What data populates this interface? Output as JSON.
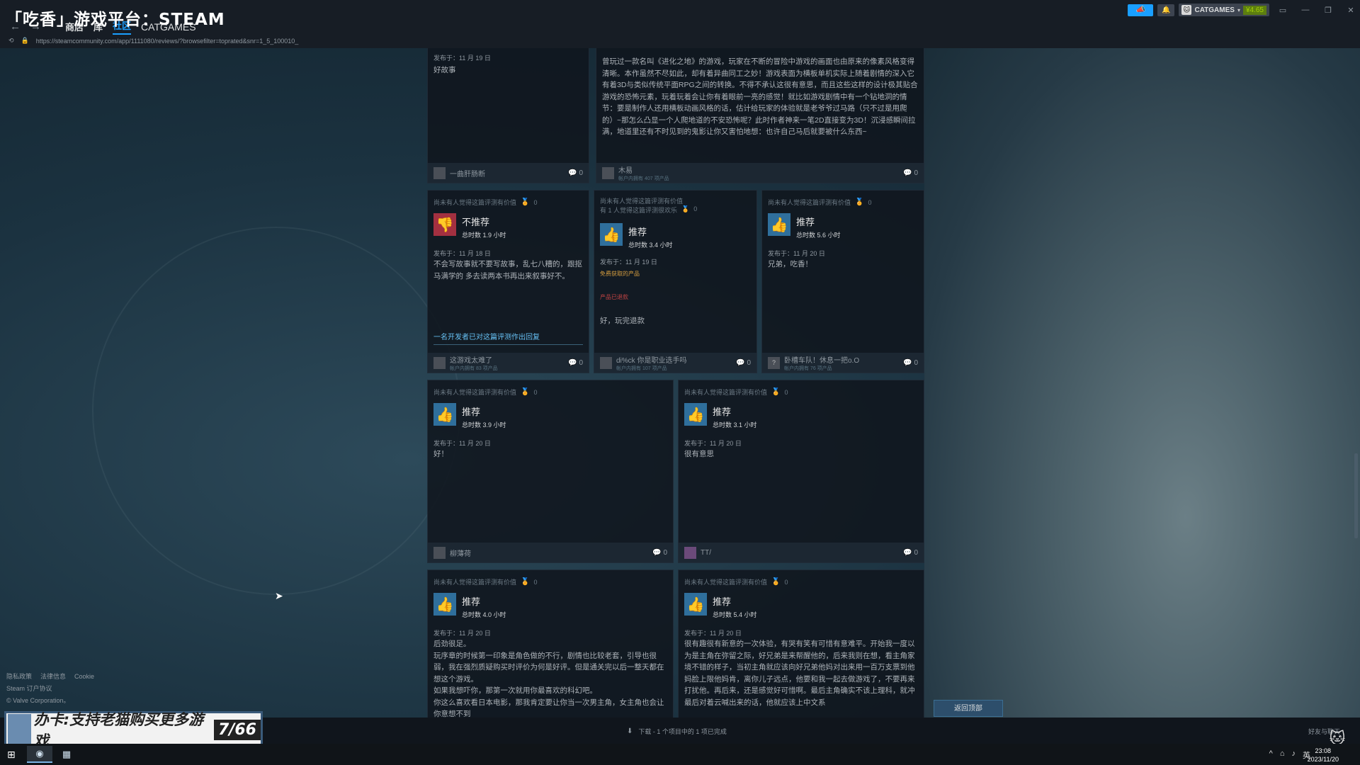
{
  "overlay_title": "「吃香」游戏平台：STEAM",
  "nav": {
    "store": "商店",
    "library": "库",
    "community": "社区",
    "username_tab": "CATGAMES"
  },
  "url": "https://steamcommunity.com/app/1111080/reviews/?browsefilter=toprated&snr=1_5_100010_",
  "account": {
    "name": "CATGAMES",
    "wallet": "¥4.65"
  },
  "reviews": [
    {
      "id": "r1",
      "posted": "发布于：11 月 19 日",
      "body": "好故事",
      "user": "一曲肝肠断",
      "user_sub": "",
      "comments": "0"
    },
    {
      "id": "r2",
      "body": "曾玩过一款名叫《进化之地》的游戏，玩家在不断的冒险中游戏的画面也由原来的像素风格变得清晰。本作虽然不尽如此，却有着异曲同工之妙！游戏表面为横板单机实际上随着剧情的深入它有着3D与类似传统平面RPG之间的转换。不得不承认这很有意思，而且这些这样的设计极其贴合游戏的恐怖元素，玩着玩着会让你有着眼前一亮的感觉！就比如游戏剧情中有一个钻地洞的情节：要是制作人还用横板动画风格的话，估计给玩家的体验就是老爷爷过马路（只不过是用爬的）~那怎么凸显一个人爬地道的不安恐怖呢？此时作者神来一笔2D直接变为3D！沉浸感瞬间拉满，地道里还有不时见到的鬼影让你又害怕地想：也许自己马后就要被什么东西~",
      "user": "木易",
      "user_sub": "帐户内拥有 407 项产品",
      "comments": "0"
    },
    {
      "id": "r3",
      "helpful": "尚未有人觉得这篇评测有价值",
      "award": "0",
      "verdict": "不推荐",
      "hours": "总时数 1.9 小时",
      "posted": "发布于：11 月 18 日",
      "body": "不会写故事就不要写故事，乱七八糟的，跟抠马满学的 多去读两本书再出来叙事好不。",
      "dev_reply": "一名开发者已对这篇评测作出回复",
      "user": "这游戏太难了",
      "user_sub": "帐户内拥有 83 项产品",
      "comments": "0"
    },
    {
      "id": "r4",
      "helpful": "尚未有人觉得这篇评测有价值",
      "helpful2": "有 1 人觉得这篇评测很欢乐",
      "award": "0",
      "verdict": "推荐",
      "hours": "总时数 3.4 小时",
      "posted": "发布于：11 月 19 日",
      "free_tag": "免费获取的产品",
      "refund_tag": "产品已退款",
      "body": "好，玩完退款",
      "user": "di%ck 你是职业选手吗",
      "user_sub": "帐户内拥有 107 项产品",
      "comments": "0"
    },
    {
      "id": "r5",
      "helpful": "尚未有人觉得这篇评测有价值",
      "award": "0",
      "verdict": "推荐",
      "hours": "总时数 5.6 小时",
      "posted": "发布于：11 月 20 日",
      "body": "兄弟，吃香！",
      "user": "卧槽车队！休息一把o.O",
      "user_sub": "帐户内拥有 76 项产品",
      "comments": "0"
    },
    {
      "id": "r6",
      "helpful": "尚未有人觉得这篇评测有价值",
      "award": "0",
      "verdict": "推荐",
      "hours": "总时数 3.9 小时",
      "posted": "发布于：11 月 20 日",
      "body": "好！",
      "user": "柳薄荷",
      "user_sub": "",
      "comments": "0"
    },
    {
      "id": "r7",
      "helpful": "尚未有人觉得这篇评测有价值",
      "award": "0",
      "verdict": "推荐",
      "hours": "总时数 3.1 小时",
      "posted": "发布于：11 月 20 日",
      "body": "很有意思",
      "user": "TT/",
      "user_sub": "",
      "comments": "0"
    },
    {
      "id": "r8",
      "helpful": "尚未有人觉得这篇评测有价值",
      "award": "0",
      "verdict": "推荐",
      "hours": "总时数 4.0 小时",
      "posted": "发布于：11 月 20 日",
      "body": "后劲很足。\n玩序章的时候第一印象是角色做的不行，剧情也比较老套，引导也很弱，我在强烈质疑购买时评价为何是好评。但是通关完以后一整天都在想这个游戏。\n如果我想吓你，那第一次就用你最喜欢的科幻吧。\n你这么喜欢看日本电影，那我肯定要让你当一次男主角，女主角也会让你意想不到"
    },
    {
      "id": "r9",
      "helpful": "尚未有人觉得这篇评测有价值",
      "award": "0",
      "verdict": "推荐",
      "hours": "总时数 5.4 小时",
      "posted": "发布于：11 月 20 日",
      "body": "很有趣很有新意的一次体验，有哭有笑有可惜有意难平。开始我一度以为是主角在弥留之际，好兄弟是来帮醒他的，后来我则在想，看主角家境不错的样子，当初主角就应该向好兄弟他妈对出来用一百万支票到他妈脸上限他妈肯，离你儿子远点，他要和我一起去做游戏了，不要再来打扰他。再后来，还是感觉好可惜啊。最后主角确实不该上理科，就冲最后对着云喊出来的话，他就应该上中文系"
    }
  ],
  "footer": {
    "privacy": "隐私政策",
    "legal": "法律信息",
    "cookie": "Cookie",
    "ssa": "Steam 订户协议",
    "copyright": "© Valve Corporation。"
  },
  "back_to_top": "返回顶部",
  "promo": {
    "text": "办卡:支持老猫购买更多游戏",
    "number": "7/66"
  },
  "download_status": "下载 - 1 个项目中的 1 项已完成",
  "friends_chat": "好友与聊天",
  "clock": {
    "time": "23:08",
    "date": "2023/11/20"
  },
  "tray_lang": "英"
}
